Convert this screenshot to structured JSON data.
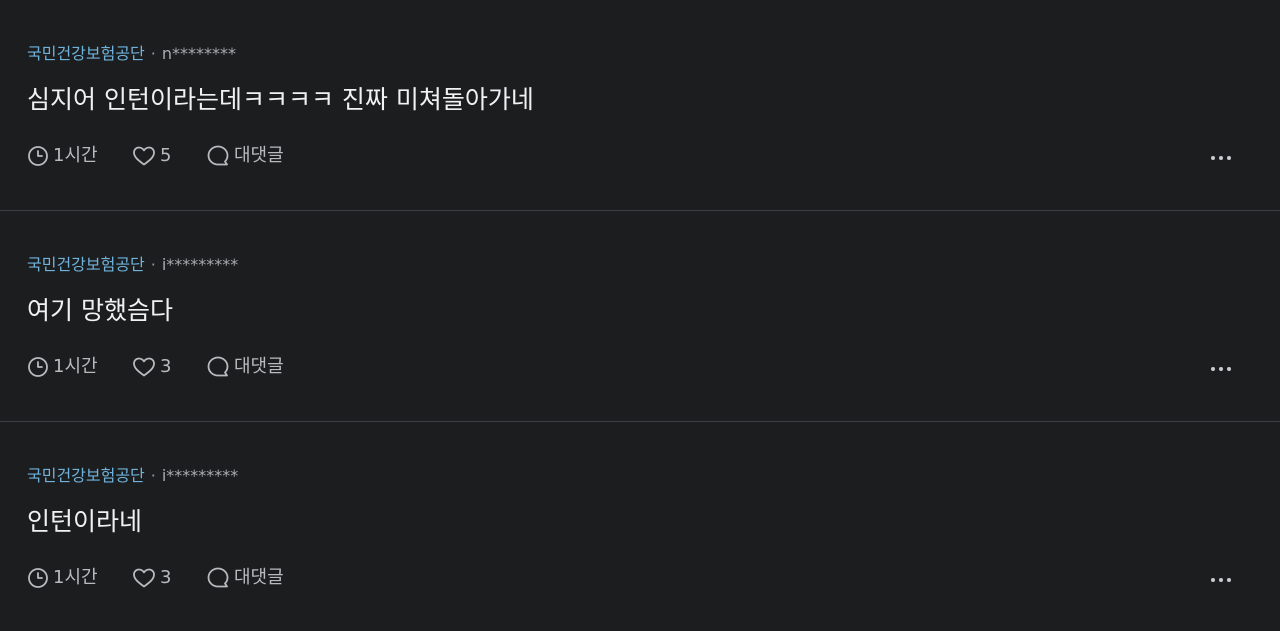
{
  "comments": [
    {
      "company": "국민건강보험공단",
      "separator": "·",
      "author": "n********",
      "text": "심지어 인턴이라는데ㅋㅋㅋㅋ 진짜 미쳐돌아가네",
      "time": "1시간",
      "likes": "5",
      "reply_label": "대댓글",
      "icons": {
        "time": "clock-icon",
        "like": "heart-icon",
        "reply": "speech-bubble-icon",
        "more": "more-dots-icon"
      }
    },
    {
      "company": "국민건강보험공단",
      "separator": "·",
      "author": "i*********",
      "text": "여기 망했슴다",
      "time": "1시간",
      "likes": "3",
      "reply_label": "대댓글",
      "icons": {
        "time": "clock-icon",
        "like": "heart-icon",
        "reply": "speech-bubble-icon",
        "more": "more-dots-icon"
      }
    },
    {
      "company": "국민건강보험공단",
      "separator": "·",
      "author": "i*********",
      "text": "인턴이라네",
      "time": "1시간",
      "likes": "3",
      "reply_label": "대댓글",
      "icons": {
        "time": "clock-icon",
        "like": "heart-icon",
        "reply": "speech-bubble-icon",
        "more": "more-dots-icon"
      }
    }
  ],
  "colors": {
    "background": "#1c1d1f",
    "company": "#6fb3dc",
    "text": "#f0f1f3",
    "muted": "#b8babd",
    "divider": "#3d3f43"
  }
}
